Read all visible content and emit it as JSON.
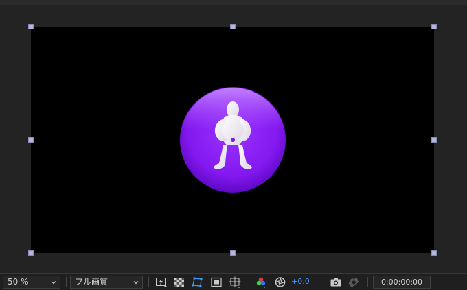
{
  "viewer": {
    "background": "#232323",
    "composition_background": "#000000",
    "logo": {
      "icon": "purple-circle-character-icon",
      "circle_color": "#8a1cf5",
      "figure_color": "#ffffff"
    }
  },
  "toolbar": {
    "zoom_value": "50 %",
    "resolution_value": "フル画質",
    "exposure_value": "+0.0",
    "exposure_color": "#3e9bff",
    "timecode": "0:00:00:00",
    "icons": [
      "fast-previews-icon",
      "transparency-grid-icon",
      "mask-path-visibility-icon",
      "region-of-interest-icon",
      "grid-guides-icon",
      "show-channel-icon",
      "reset-exposure-icon",
      "snapshot-camera-icon",
      "show-snapshot-icon"
    ]
  }
}
